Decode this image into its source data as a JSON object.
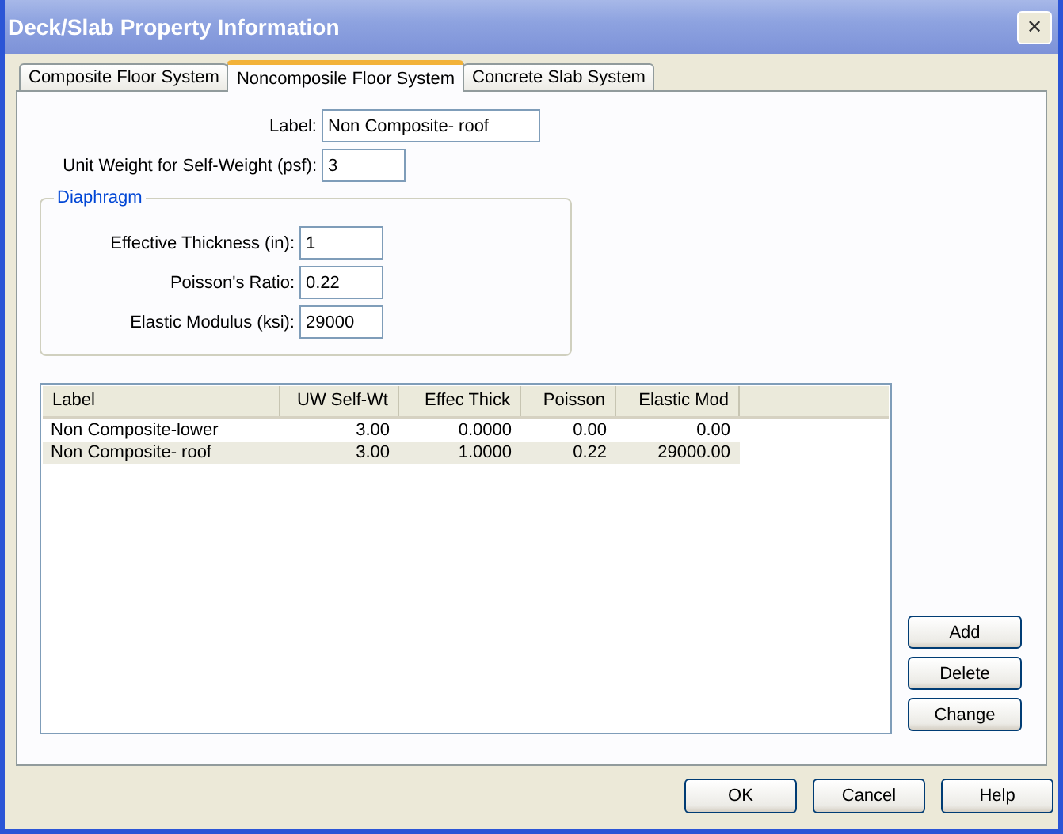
{
  "window": {
    "title": "Deck/Slab Property Information",
    "close": "✕"
  },
  "tabs": [
    {
      "label": "Composite Floor System",
      "selected": false
    },
    {
      "label": "Noncomposile Floor System",
      "selected": true
    },
    {
      "label": "Concrete Slab System",
      "selected": false
    }
  ],
  "fields": [
    {
      "label": "Label:",
      "value": "Non Composite- roof",
      "wide": true
    },
    {
      "label": "Unit Weight for Self-Weight (psf):",
      "value": "3",
      "wide": false
    }
  ],
  "diaphragm": {
    "title": "Diaphragm",
    "fields": [
      {
        "label": "Effective Thickness (in):",
        "value": "1"
      },
      {
        "label": "Poisson's Ratio:",
        "value": "0.22"
      },
      {
        "label": "Elastic Modulus (ksi):",
        "value": "29000"
      }
    ]
  },
  "table": {
    "columns": [
      "Label",
      "UW Self-Wt",
      "Effec Thick",
      "Poisson",
      "Elastic Mod"
    ],
    "rows": [
      {
        "cells": [
          "Non Composite-lower",
          "3.00",
          "0.0000",
          "0.00",
          "0.00"
        ],
        "selected": false
      },
      {
        "cells": [
          "Non Composite- roof",
          "3.00",
          "1.0000",
          "0.22",
          "29000.00"
        ],
        "selected": true
      }
    ]
  },
  "side_buttons": [
    "Add",
    "Delete",
    "Change"
  ],
  "buttons": [
    "OK",
    "Cancel",
    "Help"
  ]
}
